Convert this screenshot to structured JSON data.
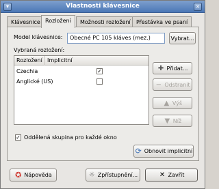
{
  "window": {
    "title": "Vlastnosti klávesnice"
  },
  "tabs": [
    "Klávesnice",
    "Rozložení",
    "Možnosti rozložení",
    "Přestávka ve psaní"
  ],
  "layout_tab": {
    "model_label": "Model klávesnice:",
    "model_value": "Obecné PC 105 kláves (mez.)",
    "choose_button": "Vybrat...",
    "selected_label": "Vybraná rozložení:",
    "columns": [
      "Rozložení",
      "Implicitní"
    ],
    "rows": [
      {
        "name": "Czechia",
        "default": true
      },
      {
        "name": "Anglické (US)",
        "default": false
      }
    ],
    "add_button": "Přidat...",
    "remove_button": "Odstranit",
    "up_button": "Výš",
    "down_button": "Níž",
    "separate_group_label": "Oddělená skupina pro každé okno",
    "separate_group_checked": true,
    "reset_button": "Obnovit implicitní"
  },
  "footer": {
    "help_button": "Nápověda",
    "accessibility_button": "Zpřístupnění...",
    "close_button": "Zavřít"
  },
  "icons": {
    "add": "plus-icon",
    "remove": "minus-icon",
    "up": "arrow-up-icon",
    "down": "arrow-down-icon",
    "reset": "refresh-icon",
    "help": "lifebuoy-icon",
    "accessibility": "accessibility-icon",
    "close": "close-x-icon"
  }
}
